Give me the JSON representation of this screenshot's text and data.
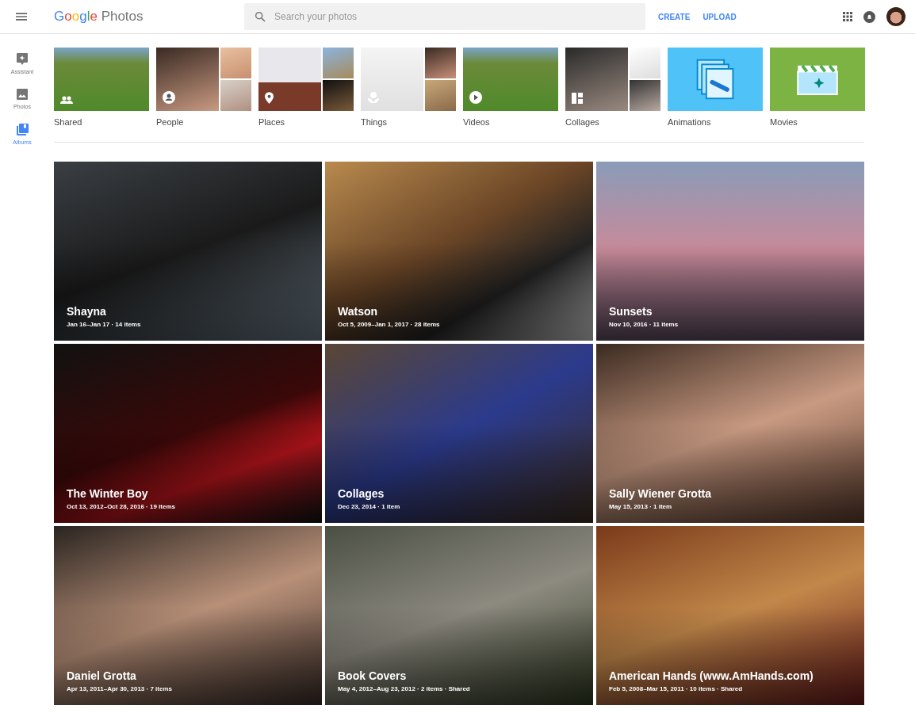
{
  "header": {
    "logo_brand": "Google",
    "logo_product": "Photos",
    "search": {
      "placeholder": "Search your photos"
    },
    "actions": [
      "CREATE",
      "UPLOAD"
    ]
  },
  "sidebar": {
    "items": [
      {
        "label": "Assistant",
        "kind": "assistant",
        "selected": false
      },
      {
        "label": "Photos",
        "kind": "photos",
        "selected": false
      },
      {
        "label": "Albums",
        "kind": "albums",
        "selected": true
      }
    ]
  },
  "categories": [
    {
      "label": "Shared",
      "kind": "shared"
    },
    {
      "label": "People",
      "kind": "people"
    },
    {
      "label": "Places",
      "kind": "places"
    },
    {
      "label": "Things",
      "kind": "things"
    },
    {
      "label": "Videos",
      "kind": "videos"
    },
    {
      "label": "Collages",
      "kind": "collages"
    },
    {
      "label": "Animations",
      "kind": "animations"
    },
    {
      "label": "Movies",
      "kind": "movies"
    }
  ],
  "albums": [
    {
      "title": "Shayna",
      "meta": "Jan 16–Jan 17 · 14 items"
    },
    {
      "title": "Watson",
      "meta": "Oct 5, 2009–Jan 1, 2017 · 28 items"
    },
    {
      "title": "Sunsets",
      "meta": "Nov 10, 2016 · 11 items"
    },
    {
      "title": "The Winter Boy",
      "meta": "Oct 13, 2012–Oct 28, 2016 · 19 items"
    },
    {
      "title": "Collages",
      "meta": "Dec 23, 2014 · 1 item"
    },
    {
      "title": "Sally Wiener Grotta",
      "meta": "May 15, 2013 · 1 item"
    },
    {
      "title": "Daniel Grotta",
      "meta": "Apr 13, 2011–Apr 30, 2013 · 7 items"
    },
    {
      "title": "Book Covers",
      "meta": "May 4, 2012–Aug 23, 2012 · 2 items · Shared"
    },
    {
      "title": "American Hands (www.AmHands.com)",
      "meta": "Feb 5, 2008–Mar 15, 2011 · 10 items · Shared"
    }
  ]
}
